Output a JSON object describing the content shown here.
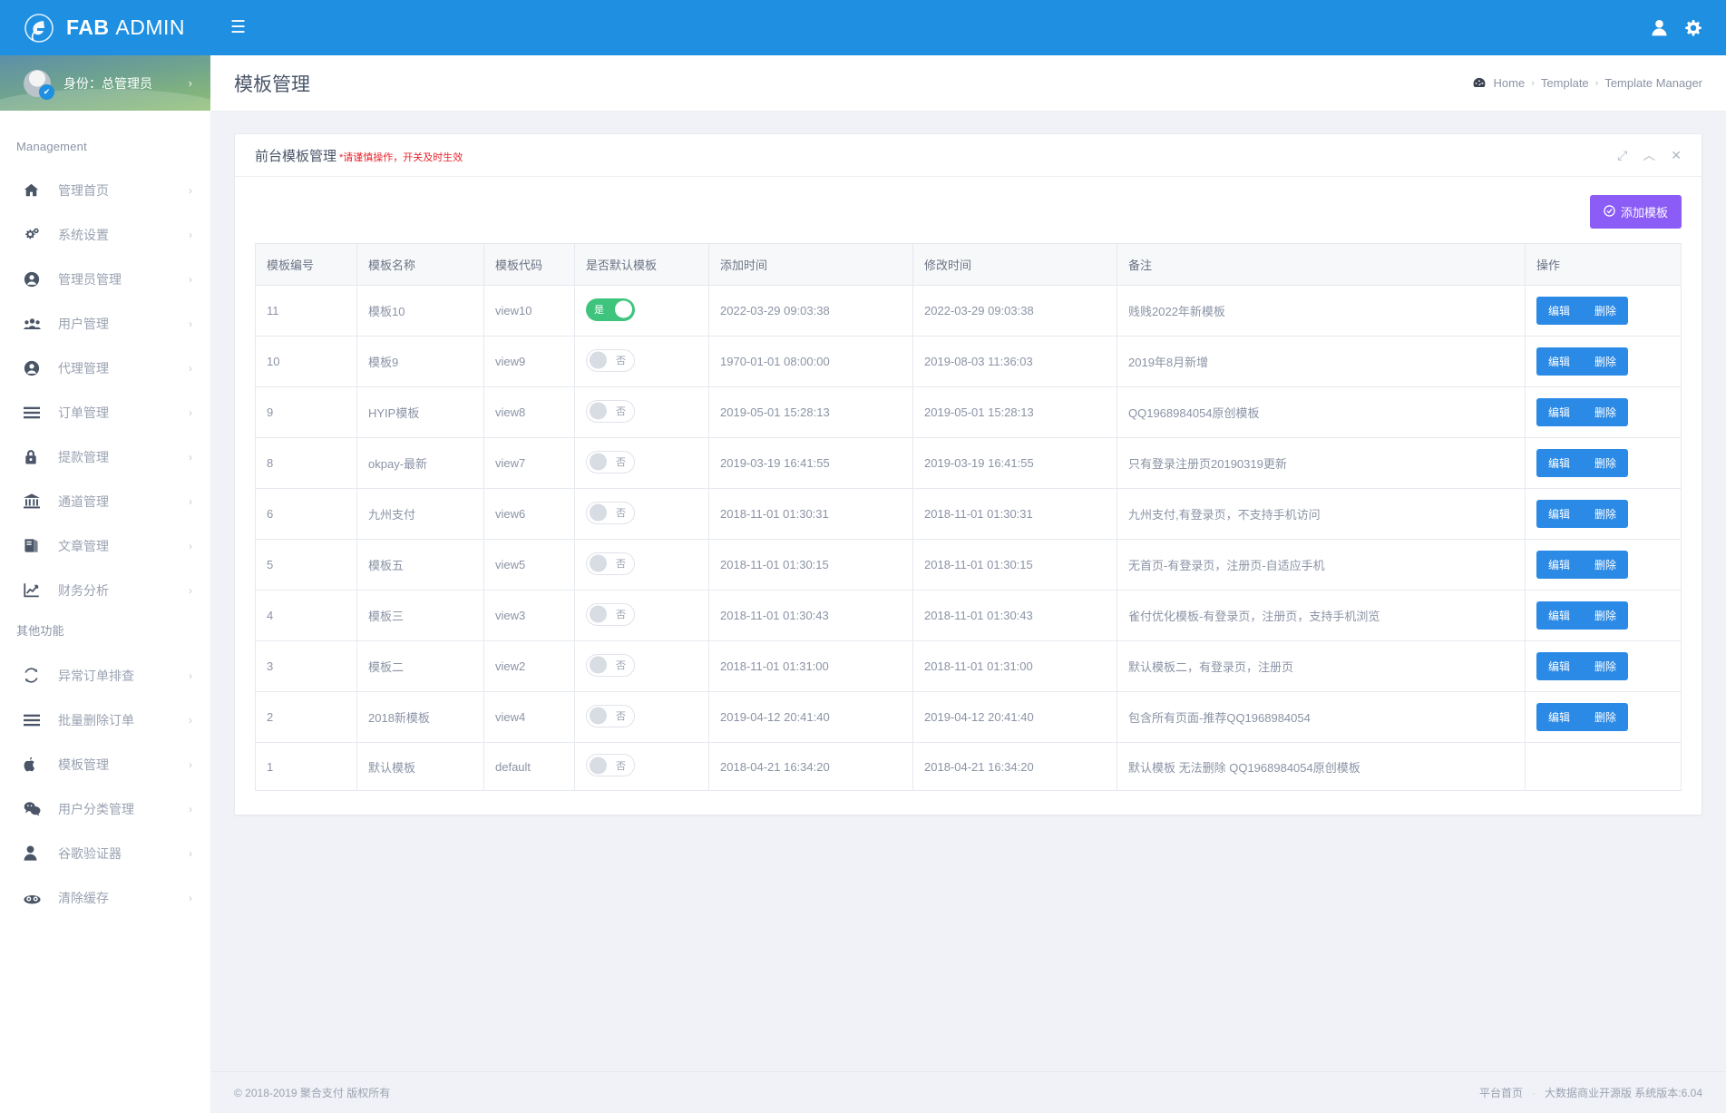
{
  "brand": {
    "bold": "FAB",
    "light": "ADMIN",
    "logo_icon": "leaf-logo-icon"
  },
  "profile": {
    "label": "身份：总管理员",
    "arrow": "›"
  },
  "topbar": {
    "hamburger": "☰",
    "user_icon": "user-icon",
    "settings_icon": "gear-icon"
  },
  "sidebar": {
    "sections": [
      {
        "title": "Management",
        "items": [
          {
            "label": "管理首页",
            "icon": "home-icon",
            "arrow": "›"
          },
          {
            "label": "系统设置",
            "icon": "gears-icon",
            "arrow": "›"
          },
          {
            "label": "管理员管理",
            "icon": "user-circle-icon",
            "arrow": "›"
          },
          {
            "label": "用户管理",
            "icon": "users-icon",
            "arrow": "›"
          },
          {
            "label": "代理管理",
            "icon": "user-circle-icon",
            "arrow": "›"
          },
          {
            "label": "订单管理",
            "icon": "list-icon",
            "arrow": "›"
          },
          {
            "label": "提款管理",
            "icon": "lock-icon",
            "arrow": "›"
          },
          {
            "label": "通道管理",
            "icon": "bank-icon",
            "arrow": "›"
          },
          {
            "label": "文章管理",
            "icon": "book-icon",
            "arrow": "›"
          },
          {
            "label": "财务分析",
            "icon": "chart-line-icon",
            "arrow": "›"
          }
        ]
      },
      {
        "title": "其他功能",
        "items": [
          {
            "label": "异常订单排查",
            "icon": "refresh-icon",
            "arrow": "›"
          },
          {
            "label": "批量删除订单",
            "icon": "list-icon",
            "arrow": "›"
          },
          {
            "label": "模板管理",
            "icon": "apple-icon",
            "arrow": "›"
          },
          {
            "label": "用户分类管理",
            "icon": "wechat-icon",
            "arrow": "›"
          },
          {
            "label": "谷歌验证器",
            "icon": "person-icon",
            "arrow": "›"
          },
          {
            "label": "清除缓存",
            "icon": "cloud-icon",
            "arrow": "›"
          }
        ]
      }
    ]
  },
  "page": {
    "title": "模板管理",
    "breadcrumb": {
      "icon": "dashboard-icon",
      "items": [
        "Home",
        "Template",
        "Template Manager"
      ],
      "separator": "›"
    }
  },
  "panel": {
    "title": "前台模板管理",
    "warning": "*请谨慎操作，开关及时生效",
    "tools": [
      {
        "name": "expand-icon",
        "glyph": "⤢"
      },
      {
        "name": "collapse-icon",
        "glyph": "︿"
      },
      {
        "name": "close-icon",
        "glyph": "✕"
      }
    ],
    "add_button": {
      "label": "添加模板",
      "icon": "check-circle-icon",
      "color": "#8b5cf6"
    }
  },
  "table": {
    "headers": [
      "模板编号",
      "模板名称",
      "模板代码",
      "是否默认模板",
      "添加时间",
      "修改时间",
      "备注",
      "操作"
    ],
    "actions": {
      "edit": "编辑",
      "delete": "删除"
    },
    "switch_on_label": "是",
    "switch_off_label": "否",
    "on_color": "#3ec47c",
    "rows": [
      {
        "id": "11",
        "name": "模板10",
        "code": "view10",
        "is_default": true,
        "added": "2022-03-29 09:03:38",
        "modified": "2022-03-29 09:03:38",
        "note": "贱贱2022年新模板",
        "has_actions": true
      },
      {
        "id": "10",
        "name": "模板9",
        "code": "view9",
        "is_default": false,
        "added": "1970-01-01 08:00:00",
        "modified": "2019-08-03 11:36:03",
        "note": "2019年8月新增",
        "has_actions": true
      },
      {
        "id": "9",
        "name": "HYIP模板",
        "code": "view8",
        "is_default": false,
        "added": "2019-05-01 15:28:13",
        "modified": "2019-05-01 15:28:13",
        "note": "QQ1968984054原创模板",
        "has_actions": true
      },
      {
        "id": "8",
        "name": "okpay-最新",
        "code": "view7",
        "is_default": false,
        "added": "2019-03-19 16:41:55",
        "modified": "2019-03-19 16:41:55",
        "note": "只有登录注册页20190319更新",
        "has_actions": true
      },
      {
        "id": "6",
        "name": "九州支付",
        "code": "view6",
        "is_default": false,
        "added": "2018-11-01 01:30:31",
        "modified": "2018-11-01 01:30:31",
        "note": "九州支付,有登录页，不支持手机访问",
        "has_actions": true
      },
      {
        "id": "5",
        "name": "模板五",
        "code": "view5",
        "is_default": false,
        "added": "2018-11-01 01:30:15",
        "modified": "2018-11-01 01:30:15",
        "note": "无首页-有登录页，注册页-自适应手机",
        "has_actions": true
      },
      {
        "id": "4",
        "name": "模板三",
        "code": "view3",
        "is_default": false,
        "added": "2018-11-01 01:30:43",
        "modified": "2018-11-01 01:30:43",
        "note": "雀付优化模板-有登录页，注册页，支持手机浏览",
        "has_actions": true
      },
      {
        "id": "3",
        "name": "模板二",
        "code": "view2",
        "is_default": false,
        "added": "2018-11-01 01:31:00",
        "modified": "2018-11-01 01:31:00",
        "note": "默认模板二，有登录页，注册页",
        "has_actions": true
      },
      {
        "id": "2",
        "name": "2018新模板",
        "code": "view4",
        "is_default": false,
        "added": "2019-04-12 20:41:40",
        "modified": "2019-04-12 20:41:40",
        "note": "包含所有页面-推荐QQ1968984054",
        "has_actions": true
      },
      {
        "id": "1",
        "name": "默认模板",
        "code": "default",
        "is_default": false,
        "added": "2018-04-21 16:34:20",
        "modified": "2018-04-21 16:34:20",
        "note": "默认模板 无法删除 QQ1968984054原创模板",
        "has_actions": false
      }
    ]
  },
  "footer": {
    "copyright": "© 2018-2019 聚合支付 版权所有",
    "link": "平台首页",
    "dot": "·",
    "version": "大数据商业开源版 系统版本:6.04"
  }
}
